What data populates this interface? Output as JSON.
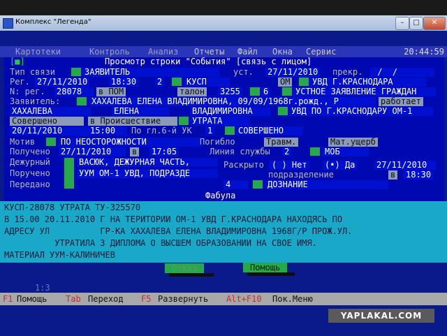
{
  "window": {
    "title": "Комплекс \"Легенда\"",
    "minimize": "–",
    "maximize": "□",
    "close": "✕"
  },
  "menu": {
    "items": [
      "Картотеки",
      "Контроль",
      "Анализ",
      "Отчеты",
      "Файл",
      "Окна",
      "Сервис"
    ],
    "clock": "20:44:59"
  },
  "dialog": {
    "marker": "[■]",
    "title": "Просмотр строки \"События\" [связь с лицом]",
    "fabula_title": "Фабула"
  },
  "labels": {
    "tip": "Тип связи",
    "reg": "Рег.",
    "nreg": "N: рег.",
    "zayav": "Заявитель:",
    "sovershen": "Совершено",
    "vproish": "в Происшествие",
    "gl6": "По гл.6-й УК",
    "motiv": "Мотив",
    "pogiblo": "Погибло",
    "travm": "Травм.",
    "matusher": "Мат.ущерб",
    "polucheno": "Получено",
    "v": "в",
    "liniya": "Линия службы",
    "dezhur": "Дежурный",
    "raskryto": "Раскрыто",
    "net": "( ) Нет",
    "da": "(•) Да",
    "porucheno": "Поручено",
    "podrazd": "подразделение",
    "peredano": "Передано",
    "ust": "уст.",
    "prekr": "прекр.",
    "talon": "талон",
    "v2": "в",
    "rabotaet": "работает",
    "vpom": "в ПОМ"
  },
  "fields": {
    "tip_val": "ЗАЯВИТЕЛЬ",
    "ust_date": "27/11/2010",
    "prekr_val": " /  /",
    "reg_date": "27/11/2010",
    "reg_time": "18:30",
    "reg_num": "2",
    "kusp": "КУСП",
    "om": "ОМ",
    "uvd": "УВД Г.КРАСНОДАРА",
    "nreg_val": "28078",
    "talon_val": "3255",
    "talon_num": "6",
    "ustnoe": "УСТНОЕ ЗАЯВЛЕНИЕ ГРАЖДАН",
    "zayav_val": "ХАХАЛЕВА ЕЛЕНА ВЛАДИМИРОВНА, 09/09/1968г.рожд., Р",
    "fam": "ХАХАЛЕВА",
    "imya": "ЕЛЕНА",
    "otch": "ВЛАДИМИРОВНА",
    "uvd2": "УВД ПО Г.КРАСНОДАРУ ОМ-1",
    "utrata": "УТРАТА",
    "sov_date": "20/11/2010",
    "sov_time": "15:00",
    "gl6_val": "1",
    "sovershen_val": "СОВЕРШЕНО",
    "motiv_val": "ПО НЕОСТОРОЖНОСТИ",
    "pol_date": "27/11/2010",
    "pol_time": "17:05",
    "liniya_num": "2",
    "mob": "МОБ",
    "dezhur_val": "ВАСЮК, ДЕЖУРНАЯ ЧАСТЬ,",
    "rask_date": "27/11/2010",
    "poruch_val": "УУМ ОМ-1 УВД, ПОДРАЗДЕ",
    "podr_v": "в",
    "podr_time": "18:30",
    "podr_num": "4",
    "doznanie": "ДОЗНАНИЕ"
  },
  "fabula": [
    "КУСП-28078 УТРАТА ТУ-325570",
    "В 15.00 20.11.2010 Г НА ТЕРИТОРИИ ОМ-1 УВД Г.КРАСНОДАРА НАХОДЯСЬ ПО",
    "АДРЕСУ УЛ          ГР-КА ХАХАЛЕВА ЕЛЕНА ВЛАДИМИРОВНА 1968Г/Р ПРОЖ.УЛ.",
    "          УТРАТИЛА 3 ДИПЛОМА О ВЫСШЕМ ОБРАЗОВАНИИ НА СВОЕ ИМЯ.",
    "МАТЕРИАЛ УУМ-КАЛИНИЧЕВ"
  ],
  "buttons": {
    "otkaz": "Отказ",
    "pomosh": "Помощь"
  },
  "pager": "1:3",
  "status": [
    {
      "key": "F1",
      "label": "Помощь"
    },
    {
      "key": "Tab",
      "label": "Переход"
    },
    {
      "key": "F5",
      "label": "Развернуть"
    },
    {
      "key": "Alt+F10",
      "label": "Пок.Меню"
    }
  ],
  "watermark": "YAPLAKAL.COM",
  "colors": {
    "field": "#0010d0",
    "accent_green": "#27a84a",
    "fabula": "#1aa8c8"
  }
}
